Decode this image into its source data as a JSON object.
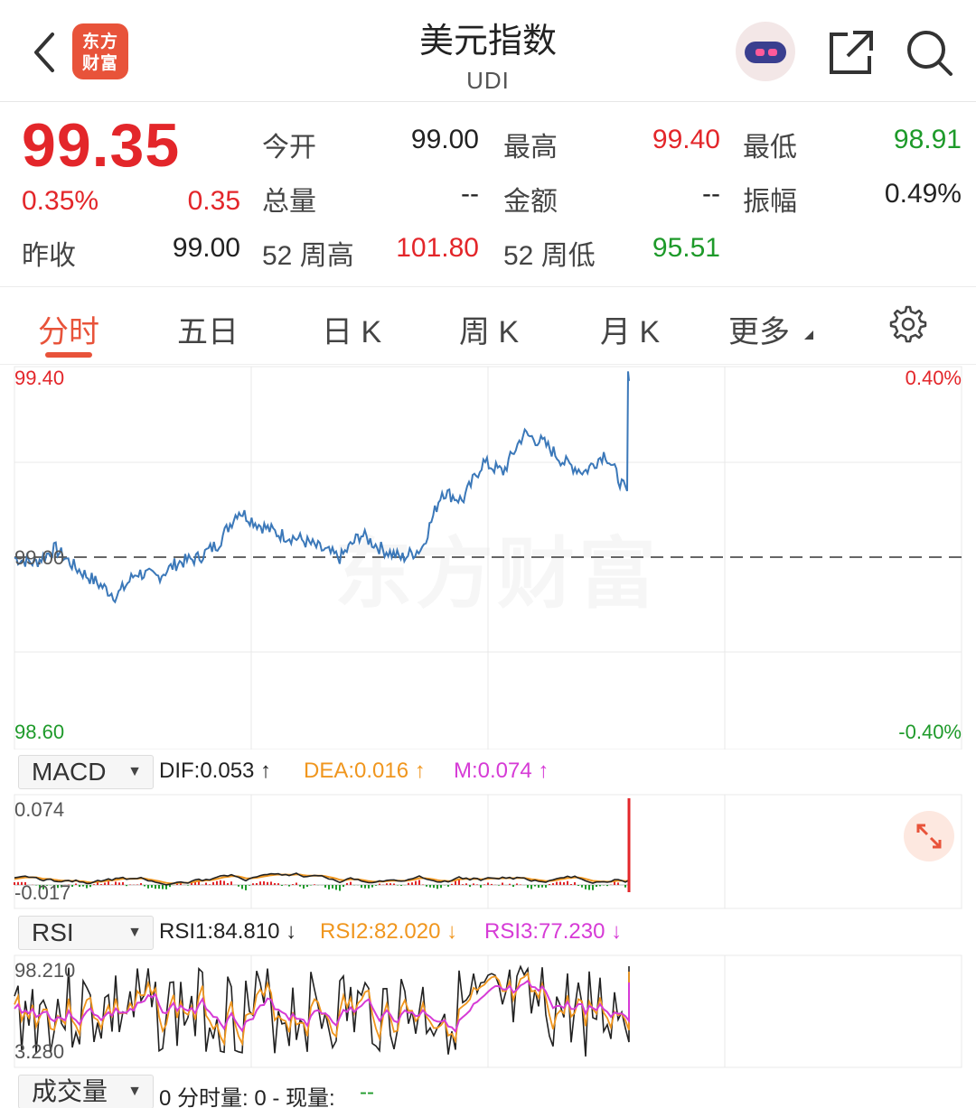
{
  "header": {
    "title": "美元指数",
    "subtitle": "UDI",
    "logo_text": "东方财富",
    "icons": [
      "back-chevron-icon",
      "robot-assistant-icon",
      "share-icon",
      "search-icon"
    ]
  },
  "quote": {
    "price": "99.35",
    "change_pct": "0.35%",
    "change": "0.35",
    "rows": [
      [
        {
          "label": "今开",
          "value": "99.00",
          "color": "#222222"
        },
        {
          "label": "最高",
          "value": "99.40",
          "color": "#e3262a"
        },
        {
          "label": "最低",
          "value": "98.91",
          "color": "#1e9a2a"
        }
      ],
      [
        {
          "label": "总量",
          "value": "--",
          "color": "#222222"
        },
        {
          "label": "金额",
          "value": "--",
          "color": "#222222"
        },
        {
          "label": "振幅",
          "value": "0.49%",
          "color": "#222222"
        }
      ]
    ],
    "prev_close_label": "昨收",
    "prev_close": "99.00",
    "week52_high_label": "52 周高",
    "week52_high": "101.80",
    "week52_low_label": "52 周低",
    "week52_low": "95.51"
  },
  "tabs": [
    {
      "label": "分时",
      "active": true
    },
    {
      "label": "五日",
      "active": false
    },
    {
      "label": "日 K",
      "active": false
    },
    {
      "label": "周 K",
      "active": false
    },
    {
      "label": "月 K",
      "active": false
    },
    {
      "label": "更多",
      "active": false
    }
  ],
  "main_chart": {
    "y_top": "99.40",
    "y_bottom": "98.60",
    "pct_top": "0.40%",
    "pct_bottom": "-0.40%",
    "prev_close_marker": "99.00",
    "watermark": "东方财富"
  },
  "macd": {
    "selector": "MACD",
    "dif": "DIF:0.053 ↑",
    "dea": "DEA:0.016 ↑",
    "m": "M:0.074 ↑",
    "y_top": "0.074",
    "y_bottom": "-0.017"
  },
  "rsi": {
    "selector": "RSI",
    "rsi1": "RSI1:84.810 ↓",
    "rsi2": "RSI2:82.020 ↓",
    "rsi3": "RSI3:77.230 ↓",
    "y_top": "98.210",
    "y_bottom": "3.280"
  },
  "volume": {
    "selector": "成交量",
    "text_a": "0 分时量: 0 - 现量:",
    "text_b": "--"
  },
  "colors": {
    "up": "#e3262a",
    "down": "#1e9a2a",
    "accent": "#e8533a",
    "price_line": "#3b78b9",
    "dea": "#f0961e",
    "m": "#d63bd6"
  },
  "chart_data": {
    "type": "line",
    "title": "",
    "xlabel": "",
    "ylabel": "",
    "ylim": [
      98.6,
      99.4
    ],
    "reference_line": 99.0,
    "series": [
      {
        "values": [
          99.0,
          98.99,
          99.02,
          98.98,
          98.95,
          98.92,
          98.97,
          98.96,
          98.99,
          99.0,
          99.03,
          99.1,
          99.07,
          99.05,
          99.04,
          99.02,
          99.0,
          99.05,
          99.02,
          99.0,
          99.02,
          99.14,
          99.12,
          99.2,
          99.18,
          99.26,
          99.24,
          99.2,
          99.18,
          99.22,
          99.14,
          99.36
        ]
      }
    ]
  }
}
